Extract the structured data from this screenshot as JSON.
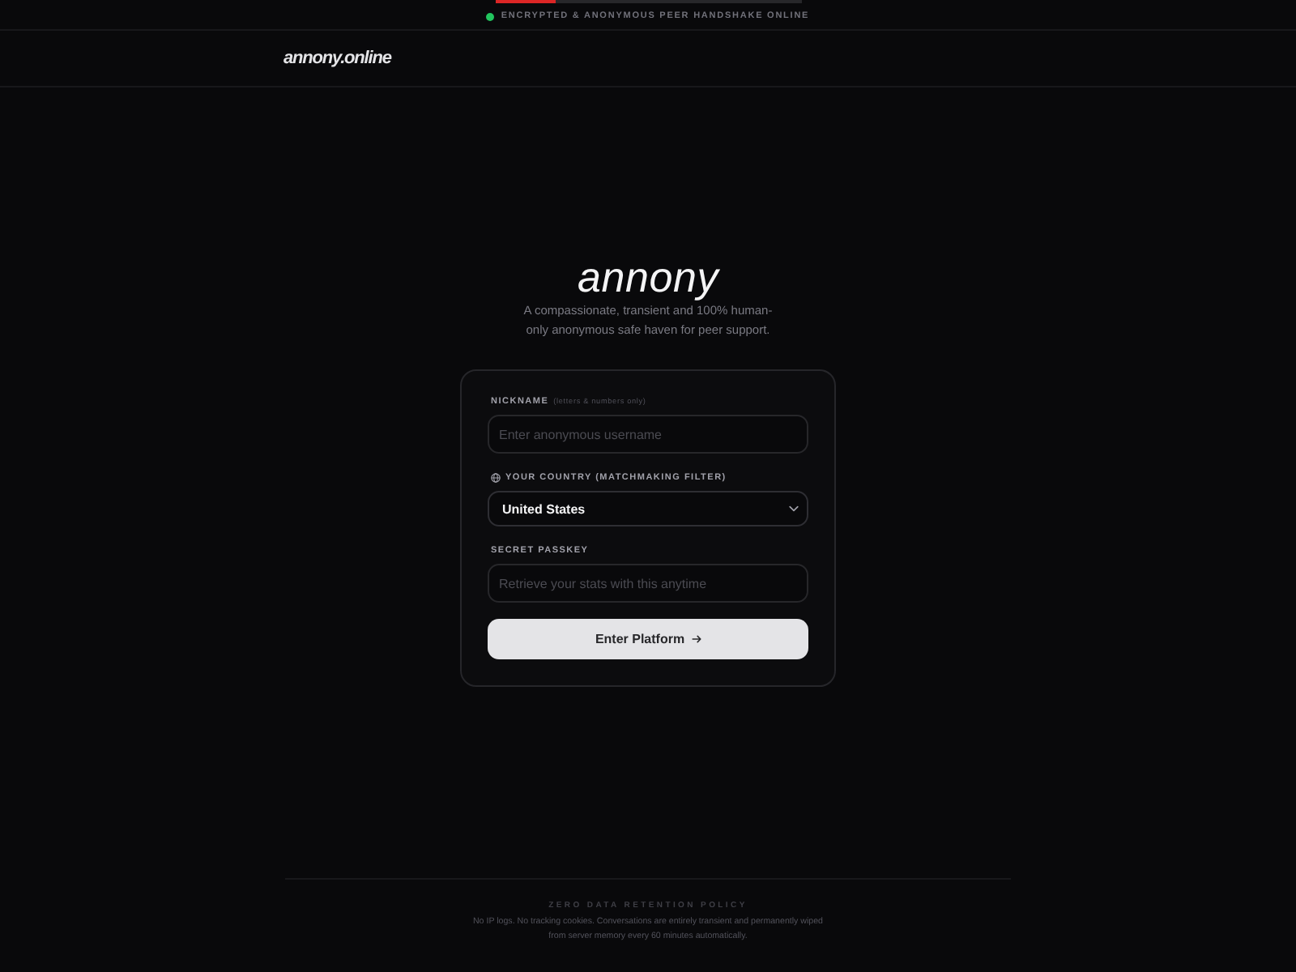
{
  "top_bar": {
    "progress": {
      "level": 0.2
    },
    "status": {
      "online": true,
      "text": "ENCRYPTED & ANONYMOUS PEER HANDSHAKE ONLINE"
    }
  },
  "header": {
    "logo": "annony.online"
  },
  "hero": {
    "title": "annony",
    "subtitle": "A compassionate, transient and 100% human-only anonymous safe haven for peer support."
  },
  "form": {
    "fields": [
      {
        "kind": "text",
        "label": "NICKNAME",
        "hint": "(letters & numbers only)",
        "placeholder": "Enter anonymous username"
      },
      {
        "kind": "select",
        "label": "YOUR COUNTRY (MATCHMAKING FILTER)",
        "value": "United States"
      },
      {
        "kind": "text",
        "label": "SECRET PASSKEY",
        "placeholder": "Retrieve your stats with this anytime"
      }
    ],
    "submit": "Enter Platform"
  },
  "footer": {
    "title": "ZERO DATA RETENTION POLICY",
    "text": "No IP logs. No tracking cookies. Conversations are entirely transient and permanently wiped from server memory every 60 minutes automatically."
  }
}
